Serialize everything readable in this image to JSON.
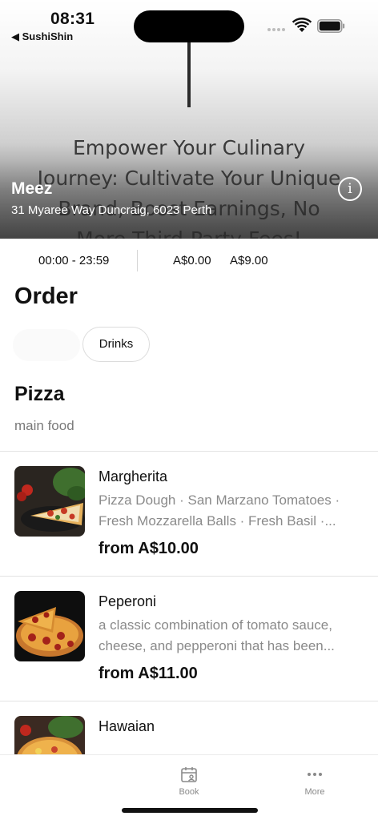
{
  "status_bar": {
    "time": "08:31",
    "back_label": "◀ SushiShin"
  },
  "hero": {
    "poster_text": "Empower Your Culinary Journey: Cultivate Your Unique Brand, Boost Earnings, No More Third-Party Fees!",
    "store_name": "Meez",
    "store_address": "31 Myaree Way Duncraig, 6023 Perth",
    "info_icon": "info-icon"
  },
  "info_row": {
    "hours": "00:00 - 23:59",
    "fee_min": "A$0.00",
    "fee_max": "A$9.00"
  },
  "order": {
    "title": "Order",
    "chips": [
      {
        "label": ""
      },
      {
        "label": "Drinks"
      }
    ]
  },
  "section": {
    "title": "Pizza",
    "subtitle": "main food"
  },
  "items": [
    {
      "name": "Margherita",
      "description": "Pizza Dough · San Marzano Tomatoes · Fresh Mozzarella Balls · Fresh Basil ·...",
      "price": "from A$10.00"
    },
    {
      "name": "Peperoni",
      "description": "a classic combination of tomato sauce, cheese, and pepperoni that has been...",
      "price": "from A$11.00"
    },
    {
      "name": "Hawaian",
      "description": "",
      "price": ""
    }
  ],
  "tab_bar": {
    "tabs": [
      {
        "label": "Book",
        "icon": "calendar-icon"
      },
      {
        "label": "More",
        "icon": "more-dots-icon"
      }
    ]
  }
}
